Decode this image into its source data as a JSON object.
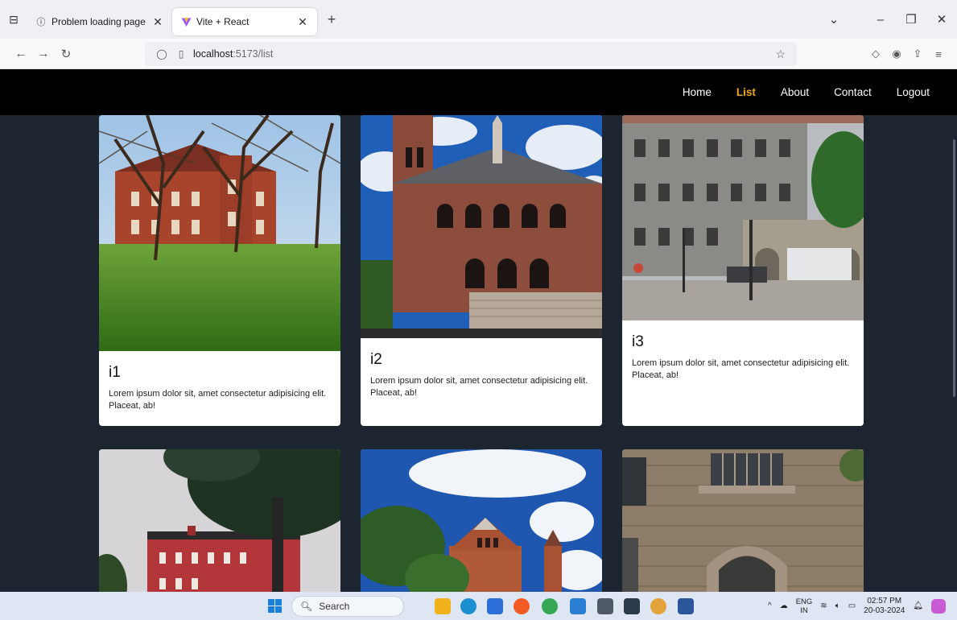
{
  "browser": {
    "tabs": [
      {
        "title": "Problem loading page",
        "icon": "info-icon",
        "active": false
      },
      {
        "title": "Vite + React",
        "icon": "vite-logo-icon",
        "active": true
      }
    ],
    "new_tab_label": "+",
    "url_host": "localhost",
    "url_path": ":5173/list"
  },
  "site": {
    "nav": [
      {
        "label": "Home",
        "active": false
      },
      {
        "label": "List",
        "active": true
      },
      {
        "label": "About",
        "active": false
      },
      {
        "label": "Contact",
        "active": false
      },
      {
        "label": "Logout",
        "active": false
      }
    ],
    "accent_color": "#f0a91c",
    "background_color": "#1d2531",
    "cards": [
      {
        "title": "i1",
        "text": "Lorem ipsum dolor sit, amet consectetur adipisicing elit. Placeat, ab!",
        "image": "campus-brick-building-trees-lawn"
      },
      {
        "title": "i2",
        "text": "Lorem ipsum dolor sit, amet consectetur adipisicing elit. Placeat, ab!",
        "image": "brick-hall-arched-windows-steps"
      },
      {
        "title": "i3",
        "text": "Lorem ipsum dolor sit, amet consectetur adipisicing elit. Placeat, ab!",
        "image": "stone-colonial-building-street"
      },
      {
        "title": "",
        "text": "",
        "image": "red-brick-building-tree"
      },
      {
        "title": "",
        "text": "",
        "image": "brick-chapel-cloudy-sky"
      },
      {
        "title": "",
        "text": "",
        "image": "stone-gothic-archway"
      }
    ]
  },
  "taskbar": {
    "search_placeholder": "Search",
    "lang_top": "ENG",
    "lang_bottom": "IN",
    "time": "02:57 PM",
    "date": "20-03-2024"
  }
}
